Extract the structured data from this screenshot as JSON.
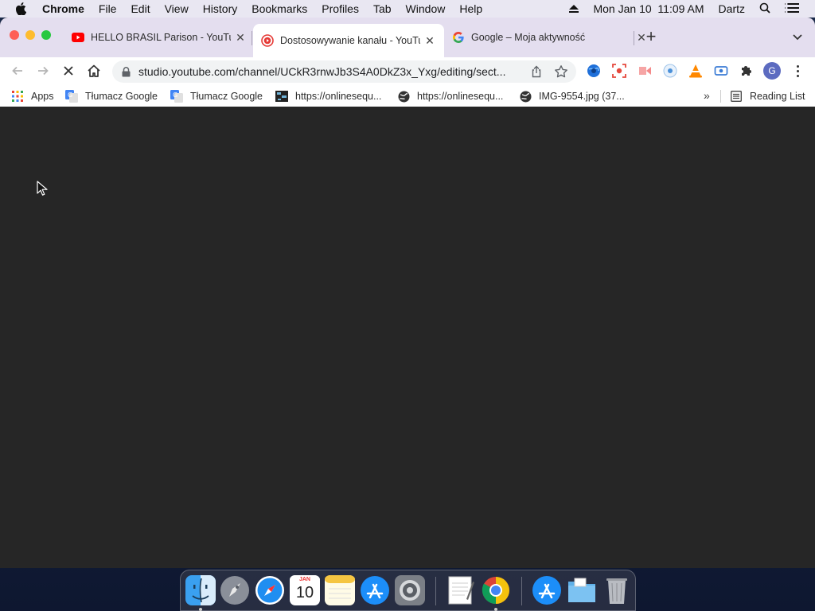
{
  "menubar": {
    "app_name": "Chrome",
    "items": [
      "File",
      "Edit",
      "View",
      "History",
      "Bookmarks",
      "Profiles",
      "Tab",
      "Window",
      "Help"
    ],
    "datetime": "Mon Jan 10  11:09 AM",
    "user": "Dartz"
  },
  "tabs": [
    {
      "title": "HELLO BRASIL Parison - YouTube",
      "favicon": "youtube-icon",
      "active": false
    },
    {
      "title": "Dostosowywanie kanału - YouTube",
      "favicon": "youtube-studio-icon",
      "active": true
    },
    {
      "title": "Google – Moja aktywność",
      "favicon": "google-icon",
      "active": false
    }
  ],
  "omnibox": {
    "url": "studio.youtube.com/channel/UCkR3rnwJb3S4A0DkZ3x_Yxg/editing/sect..."
  },
  "profile_initial": "G",
  "bookmarks": [
    {
      "label": "Apps",
      "icon": "apps-grid-icon"
    },
    {
      "label": "Tłumacz Google",
      "icon": "google-translate-icon"
    },
    {
      "label": "Tłumacz Google",
      "icon": "google-translate-icon"
    },
    {
      "label": "https://onlinesequ...",
      "icon": "sequencer-icon"
    },
    {
      "label": "https://onlinesequ...",
      "icon": "globe-icon"
    },
    {
      "label": "IMG-9554.jpg (37...",
      "icon": "globe-icon"
    }
  ],
  "reading_list_label": "Reading List",
  "dock": {
    "calendar_month": "JAN",
    "calendar_day": "10"
  },
  "colors": {
    "page_background": "#262626",
    "tabstrip": "#e4deef",
    "menubar": "#e9e7f2"
  }
}
